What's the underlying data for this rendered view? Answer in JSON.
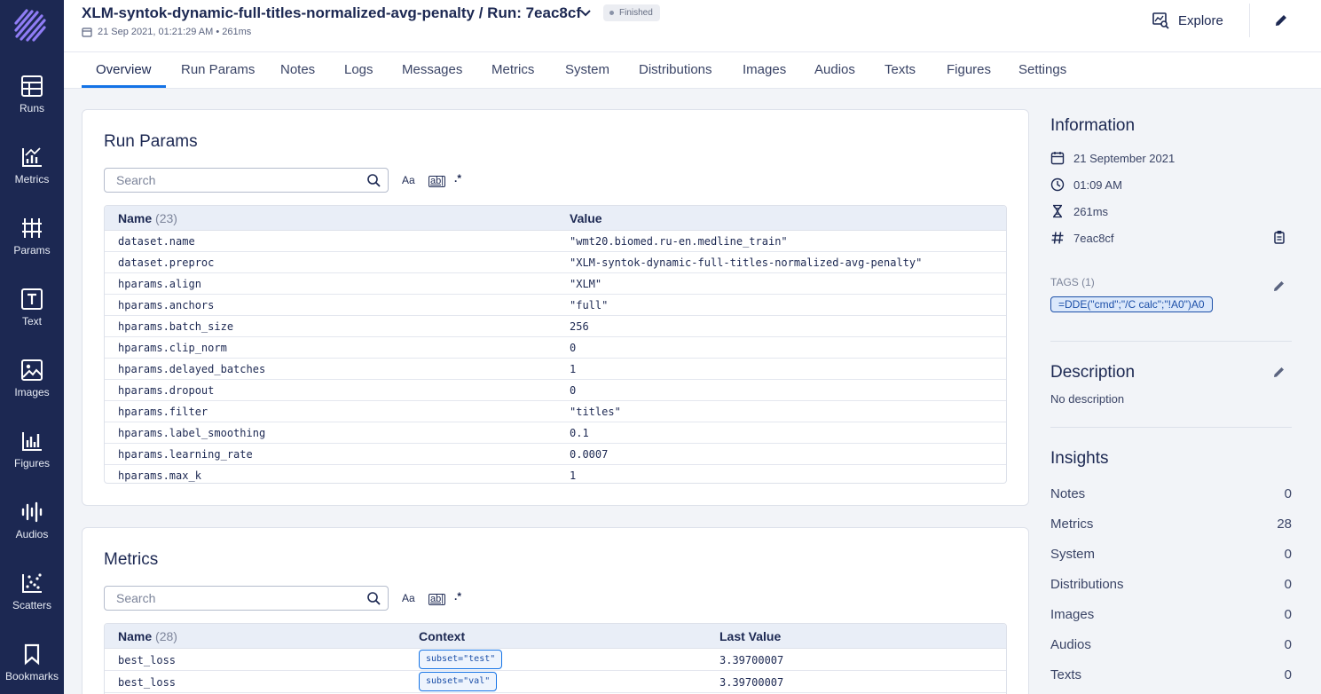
{
  "sidebar": {
    "items": [
      {
        "label": "Runs",
        "icon": "table-icon"
      },
      {
        "label": "Metrics",
        "icon": "bar-chart-icon"
      },
      {
        "label": "Params",
        "icon": "params-icon"
      },
      {
        "label": "Text",
        "icon": "text-icon"
      },
      {
        "label": "Images",
        "icon": "image-icon"
      },
      {
        "label": "Figures",
        "icon": "figures-icon"
      },
      {
        "label": "Audios",
        "icon": "audio-wave-icon"
      },
      {
        "label": "Scatters",
        "icon": "scatter-icon"
      },
      {
        "label": "Bookmarks",
        "icon": "bookmark-icon"
      }
    ]
  },
  "header": {
    "title": "XLM-syntok-dynamic-full-titles-normalized-avg-penalty  / Run: 7eac8cf",
    "status": "Finished",
    "datetime": "21 Sep 2021, 01:21:29 AM • 261ms",
    "explore_label": "Explore"
  },
  "tabs": [
    "Overview",
    "Run Params",
    "Notes",
    "Logs",
    "Messages",
    "Metrics",
    "System",
    "Distributions",
    "Images",
    "Audios",
    "Texts",
    "Figures",
    "Settings"
  ],
  "run_params": {
    "title": "Run Params",
    "search_placeholder": "Search",
    "tools": {
      "case": "Aa",
      "word": "ab|",
      "regex": ".*"
    },
    "col_name": "Name",
    "count": "(23)",
    "col_value": "Value",
    "rows": [
      {
        "name": "dataset.name",
        "value": "\"wmt20.biomed.ru-en.medline_train\""
      },
      {
        "name": "dataset.preproc",
        "value": "\"XLM-syntok-dynamic-full-titles-normalized-avg-penalty\""
      },
      {
        "name": "hparams.align",
        "value": "\"XLM\""
      },
      {
        "name": "hparams.anchors",
        "value": "\"full\""
      },
      {
        "name": "hparams.batch_size",
        "value": "256"
      },
      {
        "name": "hparams.clip_norm",
        "value": "0"
      },
      {
        "name": "hparams.delayed_batches",
        "value": "1"
      },
      {
        "name": "hparams.dropout",
        "value": "0"
      },
      {
        "name": "hparams.filter",
        "value": "\"titles\""
      },
      {
        "name": "hparams.label_smoothing",
        "value": "0.1"
      },
      {
        "name": "hparams.learning_rate",
        "value": "0.0007"
      },
      {
        "name": "hparams.max_k",
        "value": "1"
      }
    ]
  },
  "metrics": {
    "title": "Metrics",
    "search_placeholder": "Search",
    "tools": {
      "case": "Aa",
      "word": "ab|",
      "regex": ".*"
    },
    "col_name": "Name",
    "count": "(28)",
    "col_context": "Context",
    "col_last": "Last Value",
    "rows": [
      {
        "name": "best_loss",
        "context": "subset=\"test\"",
        "value": "3.39700007"
      },
      {
        "name": "best_loss",
        "context": "subset=\"val\"",
        "value": "3.39700007"
      }
    ]
  },
  "information": {
    "title": "Information",
    "date": "21 September 2021",
    "time": "01:09 AM",
    "duration": "261ms",
    "hash": "7eac8cf",
    "tags_label": "TAGS (1)",
    "tags": [
      "=DDE(\"cmd\";\"/C calc\";\"!A0\")A0"
    ]
  },
  "description": {
    "title": "Description",
    "text": "No description"
  },
  "insights": {
    "title": "Insights",
    "rows": [
      {
        "label": "Notes",
        "value": "0"
      },
      {
        "label": "Metrics",
        "value": "28"
      },
      {
        "label": "System",
        "value": "0"
      },
      {
        "label": "Distributions",
        "value": "0"
      },
      {
        "label": "Images",
        "value": "0"
      },
      {
        "label": "Audios",
        "value": "0"
      },
      {
        "label": "Texts",
        "value": "0"
      }
    ]
  },
  "colors": {
    "sidebar_bg": "#1c2852",
    "accent": "#1473e6",
    "page_bg": "#f2f4f8"
  }
}
